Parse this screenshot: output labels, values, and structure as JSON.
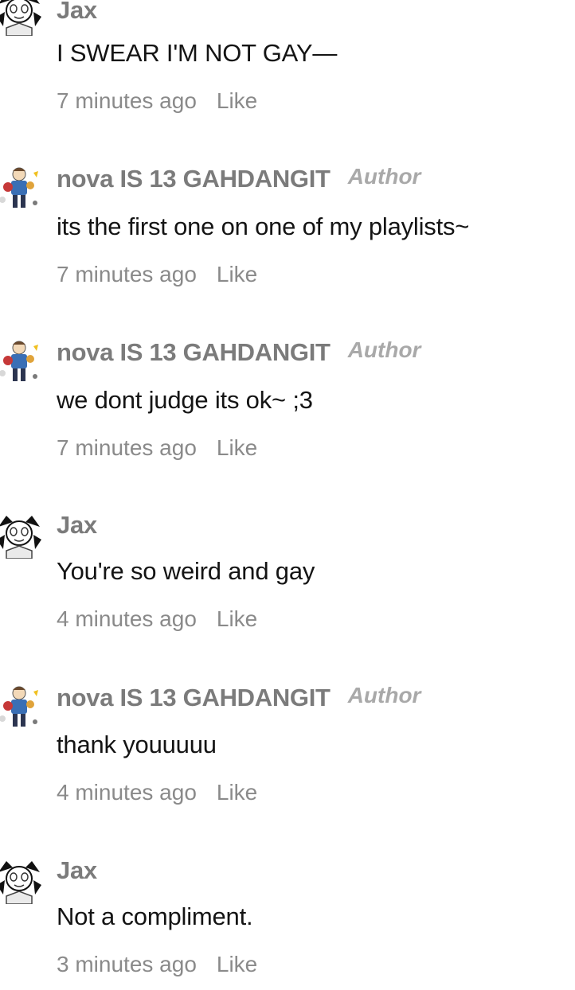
{
  "comments": [
    {
      "author": "Jax",
      "is_author": false,
      "badge": "",
      "text": "I SWEAR I'M NOT GAY—",
      "time": "7 minutes ago",
      "like_label": "Like",
      "avatar": "skull-avatar"
    },
    {
      "author": "nova IS 13 GAHDANGIT",
      "is_author": true,
      "badge": "Author",
      "text": "its the first one on one of my playlists~",
      "time": "7 minutes ago",
      "like_label": "Like",
      "avatar": "character-avatar"
    },
    {
      "author": "nova IS 13 GAHDANGIT",
      "is_author": true,
      "badge": "Author",
      "text": "we dont judge its ok~ ;3",
      "time": "7 minutes ago",
      "like_label": "Like",
      "avatar": "character-avatar"
    },
    {
      "author": "Jax",
      "is_author": false,
      "badge": "",
      "text": "You're so weird and gay",
      "time": "4 minutes ago",
      "like_label": "Like",
      "avatar": "skull-avatar"
    },
    {
      "author": "nova IS 13 GAHDANGIT",
      "is_author": true,
      "badge": "Author",
      "text": "thank youuuuu",
      "time": "4 minutes ago",
      "like_label": "Like",
      "avatar": "character-avatar"
    },
    {
      "author": "Jax",
      "is_author": false,
      "badge": "",
      "text": "Not a compliment.",
      "time": "3 minutes ago",
      "like_label": "Like",
      "avatar": "skull-avatar"
    }
  ],
  "colors": {
    "username": "#7b7b7b",
    "author_badge": "#a9a9a9",
    "body_text": "#141414",
    "meta_text": "#8a8a8a",
    "background": "#ffffff"
  }
}
